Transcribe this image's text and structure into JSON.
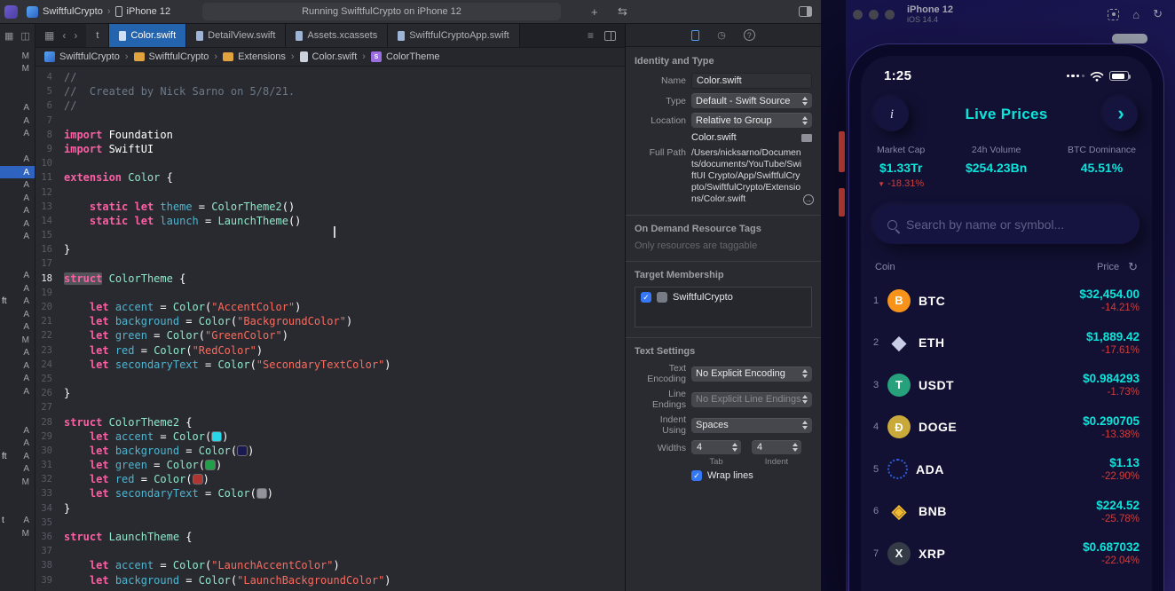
{
  "icons": {
    "plus": "+",
    "code_review": "⇆",
    "chev_left": "‹",
    "chev_right": "›",
    "related_items": "▦",
    "nav_a": "▦",
    "nav_b": "◫",
    "list": "≡",
    "crumb_sep": "›",
    "clock": "◷",
    "help": "?",
    "home": "⌂",
    "rotate": "↻",
    "refresh": "↻",
    "check": "✓",
    "down_arrow": "▼",
    "go_arrow": "→"
  },
  "xcode": {
    "toolbar": {
      "scheme_project": "SwiftfulCrypto",
      "scheme_sep": "›",
      "scheme_device": "iPhone 12",
      "status": "Running SwiftfulCrypto on iPhone 12"
    },
    "tabs": [
      {
        "label": "t",
        "active": false,
        "icon": "none"
      },
      {
        "label": "Color.swift",
        "active": true,
        "icon": "doc"
      },
      {
        "label": "DetailView.swift",
        "active": false,
        "icon": "doc"
      },
      {
        "label": "Assets.xcassets",
        "active": false,
        "icon": "doc"
      },
      {
        "label": "SwiftfulCryptoApp.swift",
        "active": false,
        "icon": "doc"
      }
    ],
    "breadcrumb": [
      {
        "label": "SwiftfulCrypto",
        "icon": "app",
        "glyph": ""
      },
      {
        "label": "SwiftfulCrypto",
        "icon": "folder",
        "glyph": ""
      },
      {
        "label": "Extensions",
        "icon": "folder",
        "glyph": ""
      },
      {
        "label": "Color.swift",
        "icon": "swift",
        "glyph": ""
      },
      {
        "label": "ColorTheme",
        "icon": "struct",
        "glyph": "S"
      }
    ],
    "navigator": {
      "rows": [
        "M",
        "M",
        "",
        "",
        "A",
        "A",
        "A",
        "",
        "A",
        "A*",
        "A",
        "A",
        "A",
        "A",
        "A",
        "",
        "",
        "A",
        "A",
        "ft A",
        "A",
        "A",
        "M",
        "A",
        "A",
        "A",
        "A",
        "",
        "",
        "A",
        "A",
        "ft A",
        "A",
        "M",
        "",
        "",
        "t A",
        "M",
        "",
        ""
      ]
    },
    "code": {
      "lines": [
        {
          "n": "4",
          "seg": [
            [
              "cm",
              "//"
            ]
          ]
        },
        {
          "n": "5",
          "seg": [
            [
              "cm",
              "//  Created by Nick Sarno on 5/8/21."
            ]
          ]
        },
        {
          "n": "6",
          "seg": [
            [
              "cm",
              "//"
            ]
          ]
        },
        {
          "n": "7",
          "seg": []
        },
        {
          "n": "8",
          "seg": [
            [
              "kw",
              "import"
            ],
            [
              "pl",
              " Foundation"
            ]
          ]
        },
        {
          "n": "9",
          "seg": [
            [
              "kw",
              "import"
            ],
            [
              "pl",
              " SwiftUI"
            ]
          ]
        },
        {
          "n": "10",
          "seg": []
        },
        {
          "n": "11",
          "seg": [
            [
              "kw",
              "extension"
            ],
            [
              "ty",
              " Color"
            ],
            [
              "pl",
              " {"
            ]
          ]
        },
        {
          "n": "12",
          "seg": []
        },
        {
          "n": "13",
          "seg": [
            [
              "pl",
              "    "
            ],
            [
              "kw",
              "static"
            ],
            [
              "pl",
              " "
            ],
            [
              "kw",
              "let"
            ],
            [
              "pl",
              " "
            ],
            [
              "pr",
              "theme"
            ],
            [
              "pl",
              " = "
            ],
            [
              "ty",
              "ColorTheme2"
            ],
            [
              "pl",
              "()"
            ]
          ]
        },
        {
          "n": "14",
          "seg": [
            [
              "pl",
              "    "
            ],
            [
              "kw",
              "static"
            ],
            [
              "pl",
              " "
            ],
            [
              "kw",
              "let"
            ],
            [
              "pl",
              " "
            ],
            [
              "pr",
              "launch"
            ],
            [
              "pl",
              " = "
            ],
            [
              "ty",
              "LaunchTheme"
            ],
            [
              "pl",
              "()"
            ]
          ]
        },
        {
          "n": "15",
          "seg": []
        },
        {
          "n": "16",
          "seg": [
            [
              "pl",
              "}"
            ]
          ]
        },
        {
          "n": "17",
          "seg": []
        },
        {
          "n": "18",
          "hl": true,
          "seg": [
            [
              "kwsel",
              "struct"
            ],
            [
              "pl",
              " "
            ],
            [
              "ty",
              "ColorTheme"
            ],
            [
              "pl",
              " {"
            ]
          ]
        },
        {
          "n": "19",
          "seg": []
        },
        {
          "n": "20",
          "seg": [
            [
              "pl",
              "    "
            ],
            [
              "kw",
              "let"
            ],
            [
              "pl",
              " "
            ],
            [
              "pr",
              "accent"
            ],
            [
              "pl",
              " = "
            ],
            [
              "ty",
              "Color"
            ],
            [
              "pl",
              "("
            ],
            [
              "str",
              "\"AccentColor\""
            ],
            [
              "pl",
              ")"
            ]
          ]
        },
        {
          "n": "21",
          "seg": [
            [
              "pl",
              "    "
            ],
            [
              "kw",
              "let"
            ],
            [
              "pl",
              " "
            ],
            [
              "pr",
              "background"
            ],
            [
              "pl",
              " = "
            ],
            [
              "ty",
              "Color"
            ],
            [
              "pl",
              "("
            ],
            [
              "str",
              "\"BackgroundColor\""
            ],
            [
              "pl",
              ")"
            ]
          ]
        },
        {
          "n": "22",
          "seg": [
            [
              "pl",
              "    "
            ],
            [
              "kw",
              "let"
            ],
            [
              "pl",
              " "
            ],
            [
              "pr",
              "green"
            ],
            [
              "pl",
              " = "
            ],
            [
              "ty",
              "Color"
            ],
            [
              "pl",
              "("
            ],
            [
              "str",
              "\"GreenColor\""
            ],
            [
              "pl",
              ")"
            ]
          ]
        },
        {
          "n": "23",
          "seg": [
            [
              "pl",
              "    "
            ],
            [
              "kw",
              "let"
            ],
            [
              "pl",
              " "
            ],
            [
              "pr",
              "red"
            ],
            [
              "pl",
              " = "
            ],
            [
              "ty",
              "Color"
            ],
            [
              "pl",
              "("
            ],
            [
              "str",
              "\"RedColor\""
            ],
            [
              "pl",
              ")"
            ]
          ]
        },
        {
          "n": "24",
          "seg": [
            [
              "pl",
              "    "
            ],
            [
              "kw",
              "let"
            ],
            [
              "pl",
              " "
            ],
            [
              "pr",
              "secondaryText"
            ],
            [
              "pl",
              " = "
            ],
            [
              "ty",
              "Color"
            ],
            [
              "pl",
              "("
            ],
            [
              "str",
              "\"SecondaryTextColor\""
            ],
            [
              "pl",
              ")"
            ]
          ]
        },
        {
          "n": "25",
          "seg": []
        },
        {
          "n": "26",
          "seg": [
            [
              "pl",
              "}"
            ]
          ]
        },
        {
          "n": "27",
          "seg": []
        },
        {
          "n": "28",
          "seg": [
            [
              "kw",
              "struct"
            ],
            [
              "pl",
              " "
            ],
            [
              "ty",
              "ColorTheme2"
            ],
            [
              "pl",
              " {"
            ]
          ]
        },
        {
          "n": "29",
          "seg": [
            [
              "pl",
              "    "
            ],
            [
              "kw",
              "let"
            ],
            [
              "pl",
              " "
            ],
            [
              "pr",
              "accent"
            ],
            [
              "pl",
              " = "
            ],
            [
              "ty",
              "Color"
            ],
            [
              "pl",
              "("
            ],
            [
              "sw",
              "#29d8e8"
            ],
            [
              "pl",
              ")"
            ]
          ]
        },
        {
          "n": "30",
          "seg": [
            [
              "pl",
              "    "
            ],
            [
              "kw",
              "let"
            ],
            [
              "pl",
              " "
            ],
            [
              "pr",
              "background"
            ],
            [
              "pl",
              " = "
            ],
            [
              "ty",
              "Color"
            ],
            [
              "pl",
              "("
            ],
            [
              "sw",
              "#1a1950"
            ],
            [
              "pl",
              ")"
            ]
          ]
        },
        {
          "n": "31",
          "seg": [
            [
              "pl",
              "    "
            ],
            [
              "kw",
              "let"
            ],
            [
              "pl",
              " "
            ],
            [
              "pr",
              "green"
            ],
            [
              "pl",
              " = "
            ],
            [
              "ty",
              "Color"
            ],
            [
              "pl",
              "("
            ],
            [
              "sw",
              "#1fa049"
            ],
            [
              "pl",
              ")"
            ]
          ]
        },
        {
          "n": "32",
          "seg": [
            [
              "pl",
              "    "
            ],
            [
              "kw",
              "let"
            ],
            [
              "pl",
              " "
            ],
            [
              "pr",
              "red"
            ],
            [
              "pl",
              " = "
            ],
            [
              "ty",
              "Color"
            ],
            [
              "pl",
              "("
            ],
            [
              "sw",
              "#b03430"
            ],
            [
              "pl",
              ")"
            ]
          ]
        },
        {
          "n": "33",
          "seg": [
            [
              "pl",
              "    "
            ],
            [
              "kw",
              "let"
            ],
            [
              "pl",
              " "
            ],
            [
              "pr",
              "secondaryText"
            ],
            [
              "pl",
              " = "
            ],
            [
              "ty",
              "Color"
            ],
            [
              "pl",
              "("
            ],
            [
              "sw",
              "#93939b"
            ],
            [
              "pl",
              ")"
            ]
          ]
        },
        {
          "n": "34",
          "seg": [
            [
              "pl",
              "}"
            ]
          ]
        },
        {
          "n": "35",
          "seg": []
        },
        {
          "n": "36",
          "seg": [
            [
              "kw",
              "struct"
            ],
            [
              "pl",
              " "
            ],
            [
              "ty",
              "LaunchTheme"
            ],
            [
              "pl",
              " {"
            ]
          ]
        },
        {
          "n": "37",
          "seg": []
        },
        {
          "n": "38",
          "seg": [
            [
              "pl",
              "    "
            ],
            [
              "kw",
              "let"
            ],
            [
              "pl",
              " "
            ],
            [
              "pr",
              "accent"
            ],
            [
              "pl",
              " = "
            ],
            [
              "ty",
              "Color"
            ],
            [
              "pl",
              "("
            ],
            [
              "str",
              "\"LaunchAccentColor\""
            ],
            [
              "pl",
              ")"
            ]
          ]
        },
        {
          "n": "39",
          "seg": [
            [
              "pl",
              "    "
            ],
            [
              "kw",
              "let"
            ],
            [
              "pl",
              " "
            ],
            [
              "pr",
              "background"
            ],
            [
              "pl",
              " = "
            ],
            [
              "ty",
              "Color"
            ],
            [
              "pl",
              "("
            ],
            [
              "str",
              "\"LaunchBackgroundColor\""
            ],
            [
              "pl",
              ")"
            ]
          ]
        }
      ]
    },
    "inspector": {
      "identity": {
        "title": "Identity and Type",
        "name_label": "Name",
        "name_value": "Color.swift",
        "type_label": "Type",
        "type_value": "Default - Swift Source",
        "location_label": "Location",
        "location_value": "Relative to Group",
        "file_value": "Color.swift",
        "fullpath_label": "Full Path",
        "fullpath_value": "/Users/nicksarno/Documents/documents/YouTube/SwiftUI Crypto/App/SwiftfulCrypto/SwiftfulCrypto/Extensions/Color.swift"
      },
      "odr": {
        "title": "On Demand Resource Tags",
        "placeholder": "Only resources are taggable"
      },
      "target": {
        "title": "Target Membership",
        "item": "SwiftfulCrypto"
      },
      "text_settings": {
        "title": "Text Settings",
        "encoding_label": "Text Encoding",
        "encoding_value": "No Explicit Encoding",
        "lineend_label": "Line Endings",
        "lineend_value": "No Explicit Line Endings",
        "indent_label": "Indent Using",
        "indent_value": "Spaces",
        "widths_label": "Widths",
        "tab_num": "4",
        "tab_sublabel": "Tab",
        "indent_num": "4",
        "indent_sublabel": "Indent",
        "wrap_label": "Wrap lines"
      }
    }
  },
  "simulator": {
    "window_title": "iPhone 12",
    "window_subtitle": "iOS 14.4",
    "status_time": "1:25",
    "header": {
      "title": "Live Prices",
      "info_glyph": "i",
      "chevron_glyph": "›"
    },
    "stats": [
      {
        "label": "Market Cap",
        "value": "$1.33Tr",
        "change": "-18.31%"
      },
      {
        "label": "24h Volume",
        "value": "$254.23Bn",
        "change": ""
      },
      {
        "label": "BTC Dominance",
        "value": "45.51%",
        "change": ""
      }
    ],
    "search_placeholder": "Search by name or symbol...",
    "list_header": {
      "coin": "Coin",
      "price": "Price"
    },
    "coins": [
      {
        "rank": "1",
        "symbol": "BTC",
        "price": "$32,454.00",
        "change": "-14.21%",
        "icon": {
          "type": "circle",
          "bg": "#f7931a",
          "glyph": "B"
        }
      },
      {
        "rank": "2",
        "symbol": "ETH",
        "price": "$1,889.42",
        "change": "-17.61%",
        "icon": {
          "type": "glyph",
          "color": "#c9cde6",
          "glyph": "◆"
        }
      },
      {
        "rank": "3",
        "symbol": "USDT",
        "price": "$0.984293",
        "change": "-1.73%",
        "icon": {
          "type": "circle",
          "bg": "#26a17b",
          "glyph": "T"
        }
      },
      {
        "rank": "4",
        "symbol": "DOGE",
        "price": "$0.290705",
        "change": "-13.38%",
        "icon": {
          "type": "circle",
          "bg": "#c9a93a",
          "glyph": "Ð"
        }
      },
      {
        "rank": "5",
        "symbol": "ADA",
        "price": "$1.13",
        "change": "-22.90%",
        "icon": {
          "type": "dots",
          "color": "#2e5dd8",
          "glyph": ""
        }
      },
      {
        "rank": "6",
        "symbol": "BNB",
        "price": "$224.52",
        "change": "-25.78%",
        "icon": {
          "type": "glyph",
          "color": "#f3ba2f",
          "glyph": "◈"
        }
      },
      {
        "rank": "7",
        "symbol": "XRP",
        "price": "$0.687032",
        "change": "-22.04%",
        "icon": {
          "type": "circle",
          "bg": "#353b46",
          "glyph": "X"
        }
      }
    ]
  }
}
